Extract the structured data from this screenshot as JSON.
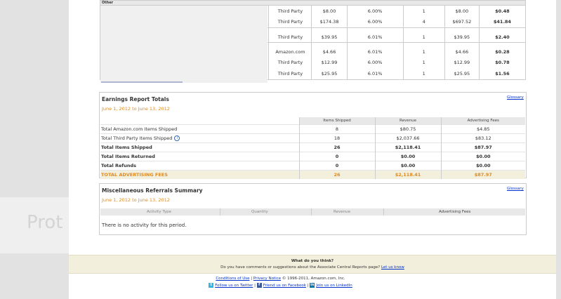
{
  "orders": {
    "header_label": "Other",
    "rows": [
      {
        "source": "Third Party",
        "price": "$8.00",
        "rate": "6.00%",
        "qty": "1",
        "revenue": "$8.00",
        "fee": "$0.48"
      },
      {
        "source": "Third Party",
        "price": "$174.38",
        "rate": "6.00%",
        "qty": "4",
        "revenue": "$697.52",
        "fee": "$41.84"
      },
      {
        "source": "Third Party",
        "price": "$39.95",
        "rate": "6.01%",
        "qty": "1",
        "revenue": "$39.95",
        "fee": "$2.40"
      },
      {
        "source": "Amazon.com",
        "price": "$4.66",
        "rate": "6.01%",
        "qty": "1",
        "revenue": "$4.66",
        "fee": "$0.28"
      },
      {
        "source": "Third Party",
        "price": "$12.99",
        "rate": "6.00%",
        "qty": "1",
        "revenue": "$12.99",
        "fee": "$0.78"
      },
      {
        "source": "Third Party",
        "price": "$25.95",
        "rate": "6.01%",
        "qty": "1",
        "revenue": "$25.95",
        "fee": "$1.56"
      }
    ]
  },
  "earnings": {
    "title": "Earnings Report Totals",
    "date_range": "June 1, 2012 to June 13, 2012",
    "glossary": "Glossary",
    "columns": [
      "Items Shipped",
      "Revenue",
      "Advertising Fees"
    ],
    "rows": [
      {
        "label": "Total Amazon.com Items Shipped",
        "items": "8",
        "revenue": "$80.75",
        "fees": "$4.85"
      },
      {
        "label": "Total Third Party Items Shipped",
        "items": "18",
        "revenue": "$2,037.66",
        "fees": "$83.12"
      },
      {
        "label": "Total Items Shipped",
        "items": "26",
        "revenue": "$2,118.41",
        "fees": "$87.97"
      },
      {
        "label": "Total Items Returned",
        "items": "0",
        "revenue": "$0.00",
        "fees": "$0.00"
      },
      {
        "label": "Total Refunds",
        "items": "0",
        "revenue": "$0.00",
        "fees": "$0.00"
      }
    ],
    "total": {
      "label": "TOTAL ADVERTISING FEES",
      "items": "26",
      "revenue": "$2,118.41",
      "fees": "$87.97"
    }
  },
  "misc": {
    "title": "Miscellaneous Referrals Summary",
    "date_range": "June 1, 2012 to June 13, 2012",
    "glossary": "Glossary",
    "columns": [
      "Activity Type",
      "Quantity",
      "Revenue",
      "Advertising Fees"
    ],
    "empty_message": "There is no activity for this period."
  },
  "feedback": {
    "title": "What do you think?",
    "text": "Do you have comments or suggestions about the Associate Central Reports page?",
    "link": "Let us know"
  },
  "footer": {
    "conditions": "Conditions of Use",
    "privacy": "Privacy Notice",
    "copyright": "© 1996-2011, Amazon.com, Inc.",
    "twitter": "Follow us on Twitter",
    "facebook": "Friend us on Facebook",
    "linkedin": "Join us on LinkedIn"
  },
  "background_text": "Prot",
  "colors": {
    "accent_orange": "#e08a1e",
    "link_blue": "#0033cc",
    "feedback_bg": "#f3efdd"
  }
}
